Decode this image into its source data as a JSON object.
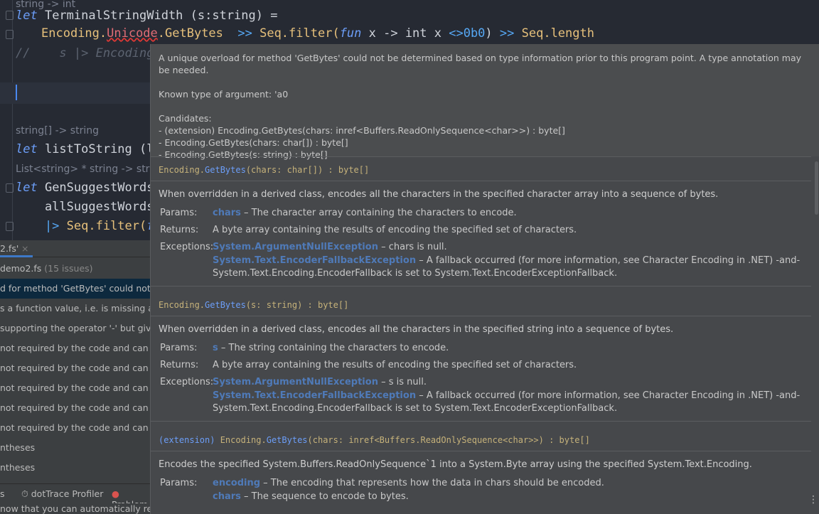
{
  "editor": {
    "line0": "string -> int",
    "line1_kw": "let",
    "line1_rest": " TerminalStringWidth (s:string) =",
    "line2_a": "Encoding.",
    "line2_err": "Unicode",
    "line2_b": ".GetBytes",
    "line2_op1": "  >>",
    "line2_c": " Seq.filter(",
    "line2_fun": "fun",
    "line2_d": " x -> int x ",
    "line2_e": "<>0b0",
    "line2_f": ") ",
    "line2_op2": ">>",
    "line2_g": " Seq.length",
    "line3": "//    s |> Encoding",
    "hint1": "string[] -> string",
    "line4_kw": "let",
    "line4_rest": " listToString (ls:",
    "hint2": "List<string> * string -> string",
    "line5_kw": "let",
    "line5_rest": " GenSuggestWords(a",
    "line6": "    allSuggestWords:L",
    "line7_op": "    |>",
    "line7_rest": " Seq.filter(",
    "line7_fun": "fun"
  },
  "problems": {
    "tab_label": "2.fs'",
    "file": "demo2.fs",
    "issues": "(15 issues)",
    "rows": [
      "d for method 'GetBytes' could not b",
      "s a function value, i.e. is missing argu",
      " supporting the operator '-' but give",
      " not required by the code and can b",
      " not required by the code and can b",
      " not required by the code and can b",
      " not required by the code and can b",
      " not required by the code and can b",
      "ntheses",
      "ntheses"
    ],
    "bottom_tabs": [
      "s",
      "dotTrace Profiler",
      "Problem"
    ],
    "status": "now that you can automatically reset"
  },
  "tooltip": {
    "error": "A unique overload for method 'GetBytes' could not be determined based on type information prior to this program point. A type annotation may be needed.",
    "known": "Known type of argument: 'a0",
    "candidates_title": "Candidates:",
    "candidates": [
      "- (extension) Encoding.GetBytes(chars: inref<Buffers.ReadOnlySequence<char>>) : byte[]",
      "- Encoding.GetBytes(chars: char[]) : byte[]",
      "- Encoding.GetBytes(s: string) : byte[]"
    ],
    "o1": {
      "sig_a": "Encoding.",
      "sig_m": "GetBytes",
      "sig_b": "(chars: char[]) : byte[]",
      "desc": "When overridden in a derived class, encodes all the characters in the specified character array into a sequence of bytes.",
      "params_label": "Params:",
      "param_name": "chars",
      "param_desc": " – The character array containing the characters to encode.",
      "returns_label": "Returns:",
      "returns": "A byte array containing the results of encoding the specified set of characters.",
      "exc_label": "Exceptions:",
      "exc1": "System.ArgumentNullException",
      "exc1_desc": " – chars is null.",
      "exc2": "System.Text.EncoderFallbackException",
      "exc2_desc": " – A fallback occurred (for more information, see Character Encoding in .NET) -and-",
      "exc2_cont": "System.Text.Encoding.EncoderFallback is set to System.Text.EncoderExceptionFallback."
    },
    "o2": {
      "sig_a": "Encoding.",
      "sig_m": "GetBytes",
      "sig_b": "(s: string) : byte[]",
      "desc": "When overridden in a derived class, encodes all the characters in the specified string into a sequence of bytes.",
      "params_label": "Params:",
      "param_name": "s",
      "param_desc": " – The string containing the characters to encode.",
      "returns_label": "Returns:",
      "returns": "A byte array containing the results of encoding the specified set of characters.",
      "exc_label": "Exceptions:",
      "exc1": "System.ArgumentNullException",
      "exc1_desc": " – s is null.",
      "exc2": "System.Text.EncoderFallbackException",
      "exc2_desc": " – A fallback occurred (for more information, see Character Encoding in .NET) -and-",
      "exc2_cont": "System.Text.Encoding.EncoderFallback is set to System.Text.EncoderExceptionFallback."
    },
    "o3": {
      "sig_ext": "(extension) ",
      "sig_a": "Encoding.",
      "sig_m": "GetBytes",
      "sig_b": "(chars: inref<Buffers.ReadOnlySequence<char>>) : byte[]",
      "desc": "Encodes the specified System.Buffers.ReadOnlySequence`1 into a System.Byte array using the specified System.Text.Encoding.",
      "params_label": "Params:",
      "p1": "encoding",
      "p1_desc": " – The encoding that represents how the data in chars should be encoded.",
      "p2": "chars",
      "p2_desc": " – The sequence to encode to bytes."
    }
  }
}
